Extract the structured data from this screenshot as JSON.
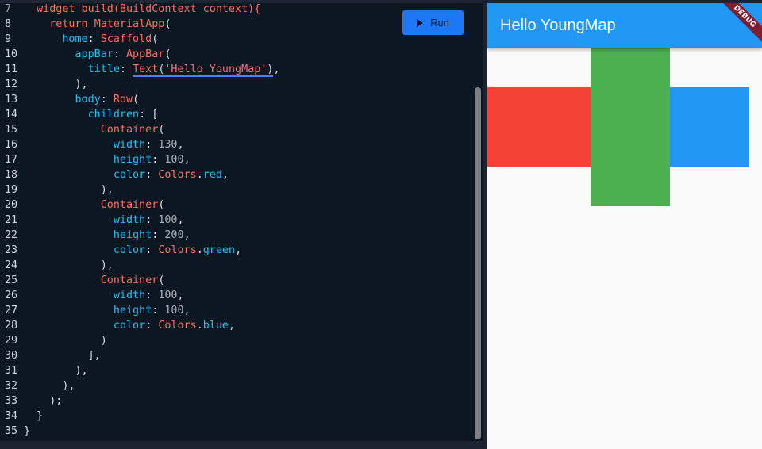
{
  "toolbar": {
    "run_label": "Run"
  },
  "editor": {
    "lines": [
      {
        "n": "7",
        "tokens": [
          [
            "kw",
            "  widget build(BuildContext context){"
          ]
        ]
      },
      {
        "n": "8",
        "tokens": [
          [
            "punc",
            "    "
          ],
          [
            "kw",
            "return"
          ],
          [
            "punc",
            " "
          ],
          [
            "kw",
            "MaterialApp"
          ],
          [
            "punc",
            "("
          ]
        ]
      },
      {
        "n": "9",
        "tokens": [
          [
            "punc",
            "      "
          ],
          [
            "prop",
            "home"
          ],
          [
            "punc",
            ": "
          ],
          [
            "kw",
            "Scaffold"
          ],
          [
            "punc",
            "("
          ]
        ]
      },
      {
        "n": "10",
        "tokens": [
          [
            "punc",
            "        "
          ],
          [
            "prop",
            "appBar"
          ],
          [
            "punc",
            ": "
          ],
          [
            "kw",
            "AppBar"
          ],
          [
            "punc",
            "("
          ]
        ]
      },
      {
        "n": "11",
        "tokens": [
          [
            "punc",
            "          "
          ],
          [
            "prop",
            "title"
          ],
          [
            "punc",
            ": "
          ],
          [
            "kw_ul",
            "Text"
          ],
          [
            "punc_ul",
            "("
          ],
          [
            "str_ul",
            "'Hello YoungMap'"
          ],
          [
            "punc_ul",
            ")"
          ],
          [
            "punc",
            ","
          ]
        ]
      },
      {
        "n": "12",
        "tokens": [
          [
            "punc",
            "        ),"
          ]
        ]
      },
      {
        "n": "13",
        "tokens": [
          [
            "punc",
            "        "
          ],
          [
            "prop",
            "body"
          ],
          [
            "punc",
            ": "
          ],
          [
            "kw",
            "Row"
          ],
          [
            "punc",
            "("
          ]
        ]
      },
      {
        "n": "14",
        "tokens": [
          [
            "punc",
            "          "
          ],
          [
            "prop",
            "children"
          ],
          [
            "punc",
            ": ["
          ]
        ]
      },
      {
        "n": "15",
        "tokens": [
          [
            "punc",
            "            "
          ],
          [
            "kw",
            "Container"
          ],
          [
            "punc",
            "("
          ]
        ]
      },
      {
        "n": "16",
        "tokens": [
          [
            "punc",
            "              "
          ],
          [
            "prop",
            "width"
          ],
          [
            "punc",
            ": "
          ],
          [
            "num",
            "130"
          ],
          [
            "punc",
            ","
          ]
        ]
      },
      {
        "n": "17",
        "tokens": [
          [
            "punc",
            "              "
          ],
          [
            "prop",
            "height"
          ],
          [
            "punc",
            ": "
          ],
          [
            "num",
            "100"
          ],
          [
            "punc",
            ","
          ]
        ]
      },
      {
        "n": "18",
        "tokens": [
          [
            "punc",
            "              "
          ],
          [
            "prop",
            "color"
          ],
          [
            "punc",
            ": "
          ],
          [
            "kw",
            "Colors"
          ],
          [
            "punc",
            "."
          ],
          [
            "prop",
            "red"
          ],
          [
            "punc",
            ","
          ]
        ]
      },
      {
        "n": "19",
        "tokens": [
          [
            "punc",
            "            ),"
          ]
        ]
      },
      {
        "n": "20",
        "tokens": [
          [
            "punc",
            "            "
          ],
          [
            "kw",
            "Container"
          ],
          [
            "punc",
            "("
          ]
        ]
      },
      {
        "n": "21",
        "tokens": [
          [
            "punc",
            "              "
          ],
          [
            "prop",
            "width"
          ],
          [
            "punc",
            ": "
          ],
          [
            "num",
            "100"
          ],
          [
            "punc",
            ","
          ]
        ]
      },
      {
        "n": "22",
        "tokens": [
          [
            "punc",
            "              "
          ],
          [
            "prop",
            "height"
          ],
          [
            "punc",
            ": "
          ],
          [
            "num",
            "200"
          ],
          [
            "punc",
            ","
          ]
        ]
      },
      {
        "n": "23",
        "tokens": [
          [
            "punc",
            "              "
          ],
          [
            "prop",
            "color"
          ],
          [
            "punc",
            ": "
          ],
          [
            "kw",
            "Colors"
          ],
          [
            "punc",
            "."
          ],
          [
            "prop",
            "green"
          ],
          [
            "punc",
            ","
          ]
        ]
      },
      {
        "n": "24",
        "tokens": [
          [
            "punc",
            "            ),"
          ]
        ]
      },
      {
        "n": "25",
        "tokens": [
          [
            "punc",
            "            "
          ],
          [
            "kw",
            "Container"
          ],
          [
            "punc",
            "("
          ]
        ]
      },
      {
        "n": "26",
        "tokens": [
          [
            "punc",
            "              "
          ],
          [
            "prop",
            "width"
          ],
          [
            "punc",
            ": "
          ],
          [
            "num",
            "100"
          ],
          [
            "punc",
            ","
          ]
        ]
      },
      {
        "n": "27",
        "tokens": [
          [
            "punc",
            "              "
          ],
          [
            "prop",
            "height"
          ],
          [
            "punc",
            ": "
          ],
          [
            "num",
            "100"
          ],
          [
            "punc",
            ","
          ]
        ]
      },
      {
        "n": "28",
        "tokens": [
          [
            "punc",
            "              "
          ],
          [
            "prop",
            "color"
          ],
          [
            "punc",
            ": "
          ],
          [
            "kw",
            "Colors"
          ],
          [
            "punc",
            "."
          ],
          [
            "prop",
            "blue"
          ],
          [
            "punc",
            ","
          ]
        ]
      },
      {
        "n": "29",
        "tokens": [
          [
            "punc",
            "            )"
          ]
        ]
      },
      {
        "n": "30",
        "tokens": [
          [
            "punc",
            "          ],"
          ]
        ]
      },
      {
        "n": "31",
        "tokens": [
          [
            "punc",
            "        ),"
          ]
        ]
      },
      {
        "n": "32",
        "tokens": [
          [
            "punc",
            "      ),"
          ]
        ]
      },
      {
        "n": "33",
        "tokens": [
          [
            "punc",
            "    );"
          ]
        ]
      },
      {
        "n": "34",
        "tokens": [
          [
            "punc",
            "  }"
          ]
        ]
      },
      {
        "n": "35",
        "tokens": [
          [
            "punc",
            "}"
          ]
        ]
      }
    ]
  },
  "preview": {
    "appbar_title": "Hello YoungMap",
    "debug_banner": "DEBUG",
    "colors": {
      "appbar": "#2196f3",
      "red": "#f44336",
      "green": "#4caf50",
      "blue": "#2196f3"
    }
  }
}
